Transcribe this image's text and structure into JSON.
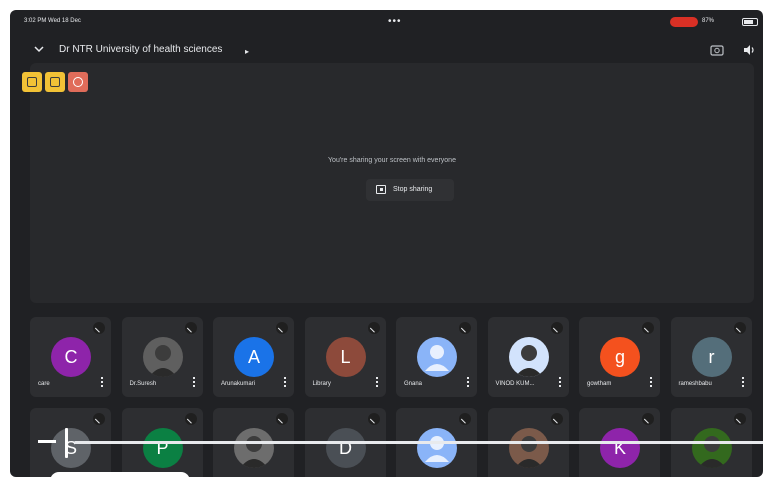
{
  "status_bar": {
    "time": "3:02 PM  Wed 18 Dec",
    "battery": "87%",
    "recording_color": "#d93025"
  },
  "header": {
    "title": "Dr NTR University of health sciences",
    "caret": "▸"
  },
  "presentation": {
    "message": "You're sharing your screen with everyone",
    "stop_label": "Stop sharing"
  },
  "participants_row1": [
    {
      "name": "care",
      "initial": "C",
      "color": "#8e24aa",
      "type": "letter"
    },
    {
      "name": "Dr.Suresh",
      "initial": "",
      "color": "#5f5f5f",
      "type": "photo"
    },
    {
      "name": "Arunakumari",
      "initial": "A",
      "color": "#1a73e8",
      "type": "letter"
    },
    {
      "name": "Library",
      "initial": "L",
      "color": "#8d4a3b",
      "type": "letter"
    },
    {
      "name": "Gnana",
      "initial": "",
      "color": "#8ab4f8",
      "type": "default"
    },
    {
      "name": "VINOD KUM...",
      "initial": "",
      "color": "#d2e3fc",
      "type": "photo"
    },
    {
      "name": "gowtham",
      "initial": "g",
      "color": "#f4511e",
      "type": "letter"
    },
    {
      "name": "rameshbabu",
      "initial": "r",
      "color": "#546e7a",
      "type": "letter"
    }
  ],
  "participants_row2": [
    {
      "initial": "S",
      "color": "#5f6368"
    },
    {
      "initial": "P",
      "color": "#0b8043"
    },
    {
      "initial": "",
      "color": "#6d6d6d"
    },
    {
      "initial": "D",
      "color": "#4a4f55"
    },
    {
      "initial": "",
      "color": "#8ab4f8"
    },
    {
      "initial": "",
      "color": "#7b5a4a"
    },
    {
      "initial": "K",
      "color": "#8e24aa"
    },
    {
      "initial": "",
      "color": "#33691e"
    }
  ]
}
